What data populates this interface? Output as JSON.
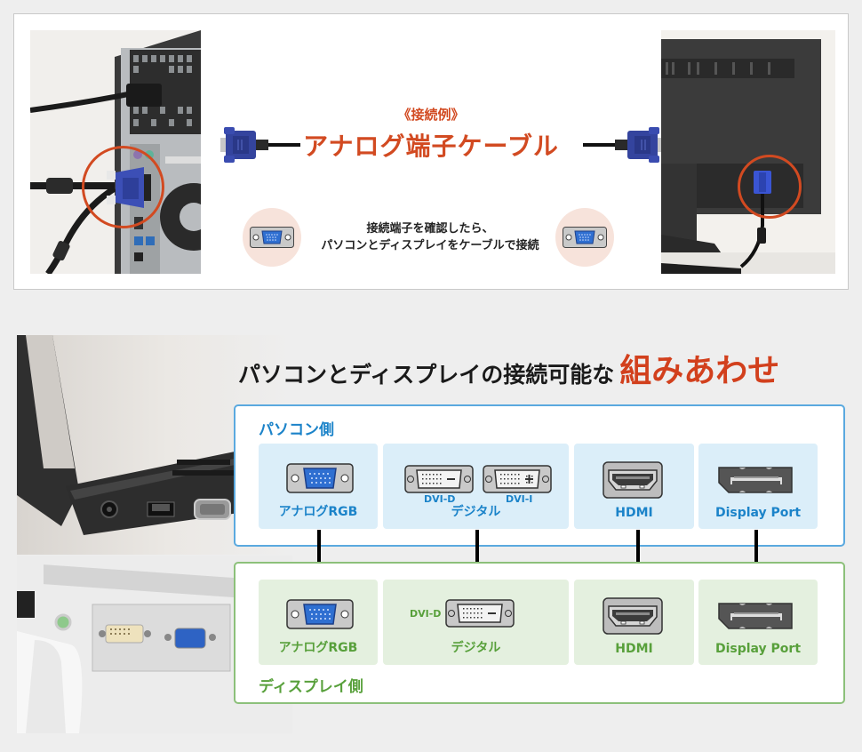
{
  "top_example": {
    "example_label": "《接続例》",
    "cable_title": "アナログ端子ケーブル",
    "instruction_line1": "接続端子を確認したら、",
    "instruction_line2": "パソコンとディスプレイをケーブルで接続",
    "photos": {
      "left": "pc-rear-vga-photo",
      "right": "monitor-rear-vga-photo"
    },
    "accent_color": "#d24a21"
  },
  "combinations": {
    "heading_main": "パソコンとディスプレイの接続可能な",
    "heading_accent": "組みあわせ",
    "pc_side": {
      "title": "パソコン側",
      "color": "#1b83c9",
      "cells": [
        {
          "label": "アナログRGB",
          "icon": "vga-port-icon"
        },
        {
          "label": "デジタル",
          "icon": "dvi-port-icon",
          "sub_labels": [
            "DVI-D",
            "DVI-I"
          ]
        },
        {
          "label": "HDMI",
          "icon": "hdmi-port-icon"
        },
        {
          "label": "Display Port",
          "icon": "displayport-port-icon"
        }
      ]
    },
    "display_side": {
      "title": "ディスプレイ側",
      "color": "#58a03b",
      "cells": [
        {
          "label": "アナログRGB",
          "icon": "vga-port-icon"
        },
        {
          "label": "デジタル",
          "icon": "dvi-port-icon",
          "sub_labels": [
            "DVI-D"
          ]
        },
        {
          "label": "HDMI",
          "icon": "hdmi-port-icon"
        },
        {
          "label": "Display Port",
          "icon": "displayport-port-icon"
        }
      ]
    }
  }
}
